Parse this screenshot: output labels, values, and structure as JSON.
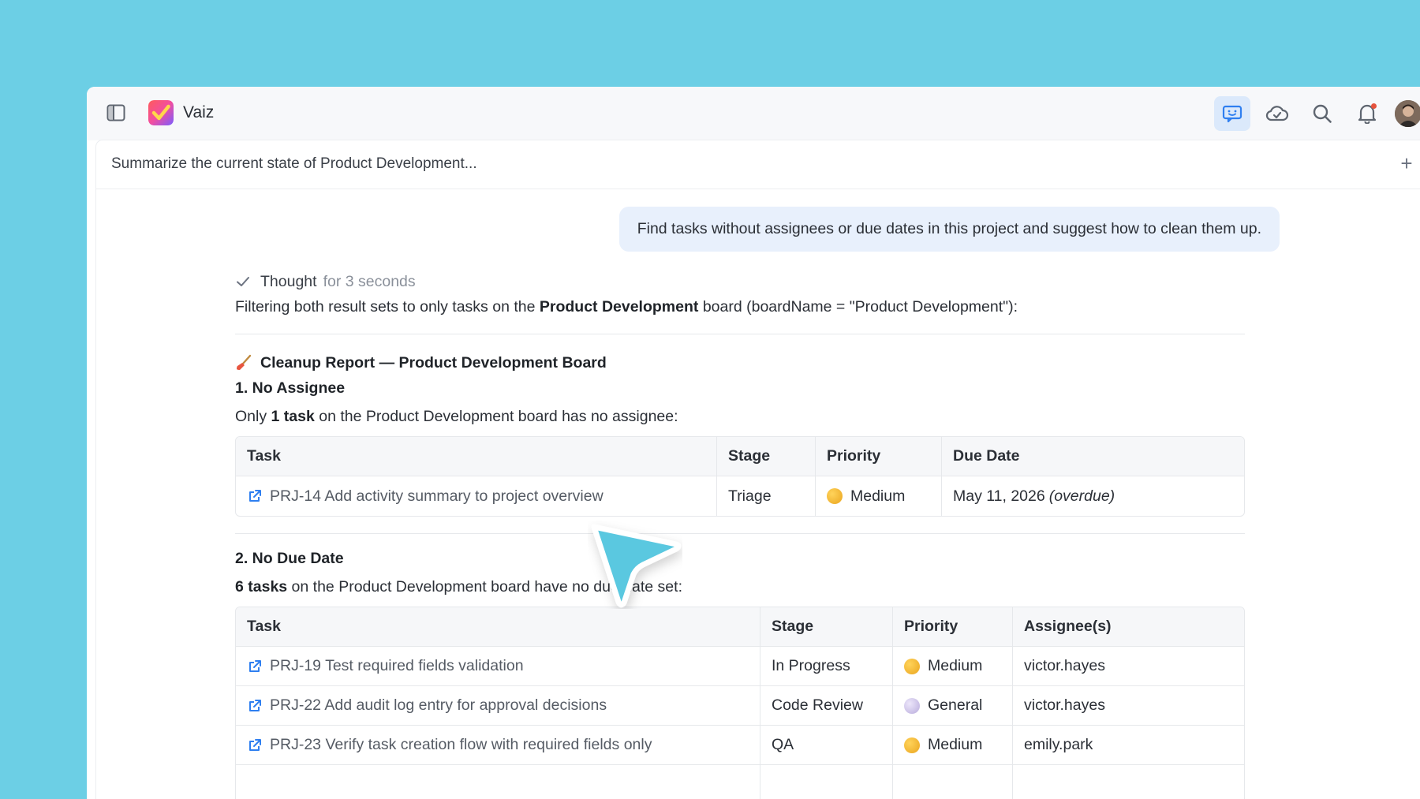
{
  "app": {
    "name": "Vaiz"
  },
  "toolbar": {
    "icons": [
      "sidebar-toggle-icon",
      "ai-chat-icon",
      "cloud-sync-icon",
      "search-icon",
      "bell-icon"
    ],
    "active": "ai-chat-icon"
  },
  "chat": {
    "title": "Summarize the current state of Product Development...",
    "new_chat_label": "+",
    "user_message": "Find tasks without assignees or due dates in this project and suggest how to clean them up.",
    "thought": {
      "label": "Thought",
      "duration": "for 3 seconds"
    },
    "intro": {
      "pre": "Filtering both result sets to only tasks on the ",
      "bold": "Product Development",
      "post": " board (boardName = \"Product Development\"):"
    },
    "report_title": "Cleanup Report — Product Development Board",
    "section1": {
      "heading": "1. No Assignee",
      "pre": "Only ",
      "bold": "1 task",
      "post": " on the Product Development board has no assignee:",
      "columns": [
        "Task",
        "Stage",
        "Priority",
        "Due Date"
      ],
      "rows": [
        {
          "task": "PRJ-14 Add activity summary to project overview",
          "stage": "Triage",
          "priority": "Medium",
          "due": "May 11, 2026",
          "note": "(overdue)"
        }
      ]
    },
    "section2": {
      "heading": "2. No Due Date",
      "bold": "6 tasks",
      "post": " on the Product Development board have no due date set:",
      "columns": [
        "Task",
        "Stage",
        "Priority",
        "Assignee(s)"
      ],
      "rows": [
        {
          "task": "PRJ-19 Test required fields validation",
          "stage": "In Progress",
          "priority": "Medium",
          "assignee": "victor.hayes"
        },
        {
          "task": "PRJ-22 Add audit log entry for approval decisions",
          "stage": "Code Review",
          "priority": "General",
          "assignee": "victor.hayes"
        },
        {
          "task": "PRJ-23 Verify task creation flow with required fields only",
          "stage": "QA",
          "priority": "Medium",
          "assignee": "emily.park"
        }
      ]
    }
  },
  "colors": {
    "background": "#6ccfe5",
    "accent": "#2f7ff0",
    "priority_medium": "#f2b632",
    "priority_general": "#c9bfe6",
    "cursor": "#5ac8e0"
  }
}
